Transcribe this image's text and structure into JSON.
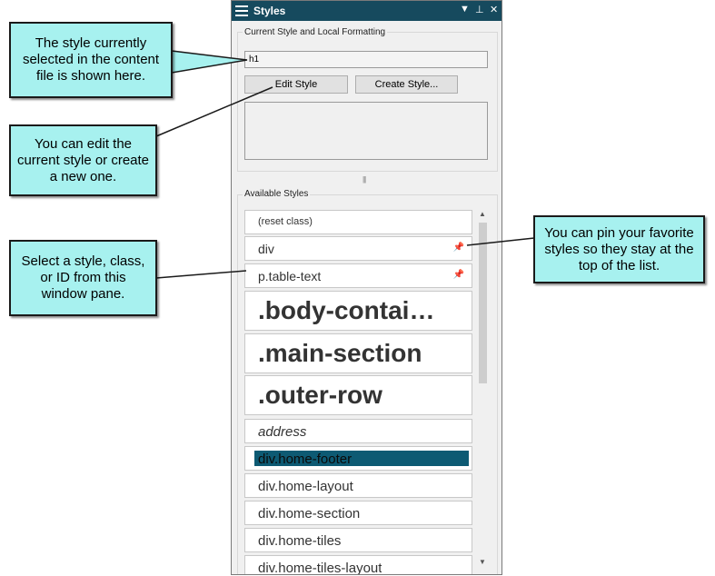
{
  "panel": {
    "title": "Styles",
    "current_group_label": "Current Style and Local Formatting",
    "current_style_value": "h1",
    "edit_style_label": "Edit Style",
    "create_style_label": "Create Style...",
    "available_group_label": "Available Styles",
    "items": [
      {
        "label": "(reset class)",
        "pinned": false
      },
      {
        "label": "div",
        "pinned": true
      },
      {
        "label": "p.table-text",
        "pinned": true
      },
      {
        "label": ".body-contai…",
        "pinned": false
      },
      {
        "label": ".main-section",
        "pinned": false
      },
      {
        "label": ".outer-row",
        "pinned": false
      },
      {
        "label": "address",
        "pinned": false
      },
      {
        "label": "div.home-footer",
        "pinned": false,
        "selected": true
      },
      {
        "label": "div.home-layout",
        "pinned": false
      },
      {
        "label": "div.home-section",
        "pinned": false
      },
      {
        "label": "div.home-tiles",
        "pinned": false
      },
      {
        "label": "div.home-tiles-layout",
        "pinned": false
      }
    ]
  },
  "callouts": {
    "current_style": "The style currently selected in the content file is shown here.",
    "edit_create": "You can edit the current style or create a new one.",
    "select_style": "Select a style, class, or ID from this window pane.",
    "pin_favorites": "You can pin your favorite styles so they stay at the top of the list."
  },
  "icons": {
    "menu": "hamburger-menu-icon",
    "dropdown": "dropdown-arrow-icon",
    "pin": "pin-icon",
    "close": "close-icon",
    "scroll_up": "scroll-up-arrow-icon",
    "scroll_down": "scroll-down-arrow-icon"
  },
  "colors": {
    "titlebar": "#164a5e",
    "callout_fill": "#a7f1ef",
    "selection": "#0d5a73"
  }
}
